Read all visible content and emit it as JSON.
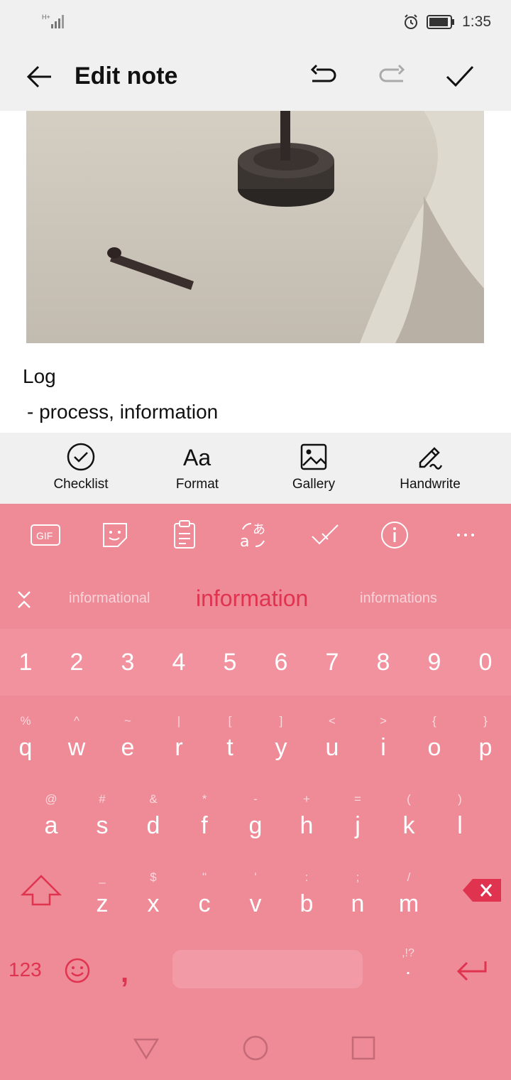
{
  "status_bar": {
    "network": "H+",
    "time": "1:35"
  },
  "app_bar": {
    "title": "Edit note"
  },
  "note": {
    "title": "Log",
    "line": " - process, information"
  },
  "toolbar": {
    "items": [
      {
        "label": "Checklist",
        "icon": "checklist-icon"
      },
      {
        "label": "Format",
        "icon": "format-icon",
        "glyph": "Aa"
      },
      {
        "label": "Gallery",
        "icon": "gallery-icon"
      },
      {
        "label": "Handwrite",
        "icon": "handwrite-icon"
      }
    ]
  },
  "keyboard": {
    "toolbar_icons": [
      "gif-icon",
      "sticker-icon",
      "clipboard-icon",
      "translate-icon",
      "spellcheck-icon",
      "info-icon",
      "more-icon"
    ],
    "gif_label": "GIF",
    "suggestions": {
      "left": "informational",
      "center": "information",
      "right": "informations"
    },
    "numbers": [
      "1",
      "2",
      "3",
      "4",
      "5",
      "6",
      "7",
      "8",
      "9",
      "0"
    ],
    "row1": [
      {
        "main": "q",
        "sub": "%"
      },
      {
        "main": "w",
        "sub": "^"
      },
      {
        "main": "e",
        "sub": "~"
      },
      {
        "main": "r",
        "sub": "|"
      },
      {
        "main": "t",
        "sub": "["
      },
      {
        "main": "y",
        "sub": "]"
      },
      {
        "main": "u",
        "sub": "<"
      },
      {
        "main": "i",
        "sub": ">"
      },
      {
        "main": "o",
        "sub": "{"
      },
      {
        "main": "p",
        "sub": "}"
      }
    ],
    "row2": [
      {
        "main": "a",
        "sub": "@"
      },
      {
        "main": "s",
        "sub": "#"
      },
      {
        "main": "d",
        "sub": "&"
      },
      {
        "main": "f",
        "sub": "*"
      },
      {
        "main": "g",
        "sub": "-"
      },
      {
        "main": "h",
        "sub": "+"
      },
      {
        "main": "j",
        "sub": "="
      },
      {
        "main": "k",
        "sub": "("
      },
      {
        "main": "l",
        "sub": ")"
      }
    ],
    "row3": [
      {
        "main": "z",
        "sub": "_"
      },
      {
        "main": "x",
        "sub": "$"
      },
      {
        "main": "c",
        "sub": "\""
      },
      {
        "main": "v",
        "sub": "'"
      },
      {
        "main": "b",
        "sub": ":"
      },
      {
        "main": "n",
        "sub": ";"
      },
      {
        "main": "m",
        "sub": "/"
      }
    ],
    "bottom": {
      "mode_key": "123",
      "comma": ",",
      "period": ".",
      "period_sub": ",!?"
    }
  },
  "colors": {
    "keyboard_bg": "#ef8a97",
    "accent": "#e0334f",
    "bar_bg": "#f0f0f0"
  }
}
